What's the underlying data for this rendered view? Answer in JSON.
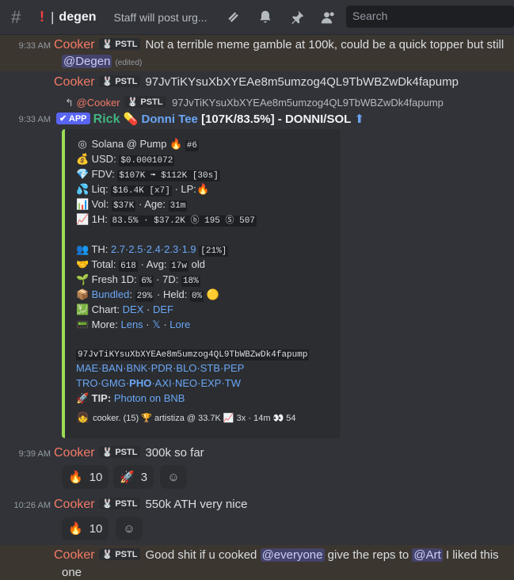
{
  "header": {
    "hash": "#",
    "bang": "!",
    "pipe": "|",
    "channel": "degen",
    "topic": "Staff will post urg...",
    "search_placeholder": "Search"
  },
  "messages": [
    {
      "time": "9:33 AM",
      "author": "Cooker",
      "tag": "PSTL",
      "text": "Not a terrible meme gamble at 100k, could be a quick topper but still",
      "mention": "@Degen",
      "edited": "(edited)"
    },
    {
      "author": "Cooker",
      "tag": "PSTL",
      "text": "97JvTiKYsuXbXYEAe8m5umzog4QL9TbWBZwDk4fapump"
    },
    {
      "reply_author": "@Cooker",
      "reply_tag": "PSTL",
      "reply_text": "97JvTiKYsuXbXYEAe8m5umzog4QL9TbWBZwDk4fapump",
      "time": "9:33 AM",
      "app": "APP",
      "author": "Rick",
      "title_name": "Donni Tee",
      "title_rest": "[107K/83.5%] - DONNI/SOL",
      "arrow": "⬆"
    },
    {
      "time": "9:39 AM",
      "author": "Cooker",
      "tag": "PSTL",
      "text": "300k so far"
    },
    {
      "time": "10:26 AM",
      "author": "Cooker",
      "tag": "PSTL",
      "text": "550k ATH very nice"
    },
    {
      "author": "Cooker",
      "tag": "PSTL",
      "text_a": "Good shit if u cooked",
      "mention_a": "@everyone",
      "text_b": "give the reps to",
      "mention_b": "@Art",
      "text_c": "I liked this",
      "text_d": "one"
    }
  ],
  "embed": {
    "l1_label": "Solana @ Pump",
    "l1_rank": "#6",
    "usd_label": "USD:",
    "usd": "$0.0001072",
    "fdv_label": "FDV:",
    "fdv": "$107K ➟ $112K [30s]",
    "liq_label": "Liq:",
    "liq": "$16.4K [x7]",
    "lp_label": "· LP:",
    "vol_label": "Vol:",
    "vol": "$37K",
    "age_label": "· Age:",
    "age": "31m",
    "h1_label": "1H:",
    "h1": "83.5% · $37.2K ⓑ 195 Ⓢ 507",
    "th_label": "TH:",
    "th": "2.7·2.5·2.4·2.3·1.9",
    "th_pct": "[21%]",
    "total_label": "Total:",
    "total": "618",
    "avg_label": "· Avg:",
    "avg": "17w",
    "avg_suffix": "old",
    "fresh_label": "Fresh 1D:",
    "fresh1d": "6%",
    "fresh7_label": "· 7D:",
    "fresh7d": "18%",
    "bundled_label": "Bundled",
    "bundled": "29%",
    "held_label": "· Held:",
    "held": "0%",
    "chart_label": "Chart:",
    "dex": "DEX",
    "def": "DEF",
    "more_label": "More:",
    "lens": "Lens",
    "x": "𝕏",
    "lore": "Lore",
    "address": "97JvTiKYsuXbXYEAe8m5umzog4QL9TbWBZwDk4fapump",
    "links1": "MAE·BAN·BNK·PDR·BLO·STB·PEP",
    "links2a": "TRO·GMG·",
    "links2b": "PHO",
    "links2c": "·AXI·NEO·EXP·TW",
    "tip_label": "TIP:",
    "tip": "Photon on BNB",
    "footer": "cooker. (15) 🏆 artistiza @ 33.7K 📈 3x · 14m 👀 54"
  },
  "reactions": [
    {
      "emoji": "🔥",
      "count": "10"
    },
    {
      "emoji": "🚀",
      "count": "3"
    },
    {
      "emoji": "🔥",
      "count": "10"
    }
  ],
  "colors": {
    "accent": "#5865f2",
    "embed_bar": "#9cdd54",
    "cooker": "#f47b67",
    "rick": "#43b581"
  }
}
